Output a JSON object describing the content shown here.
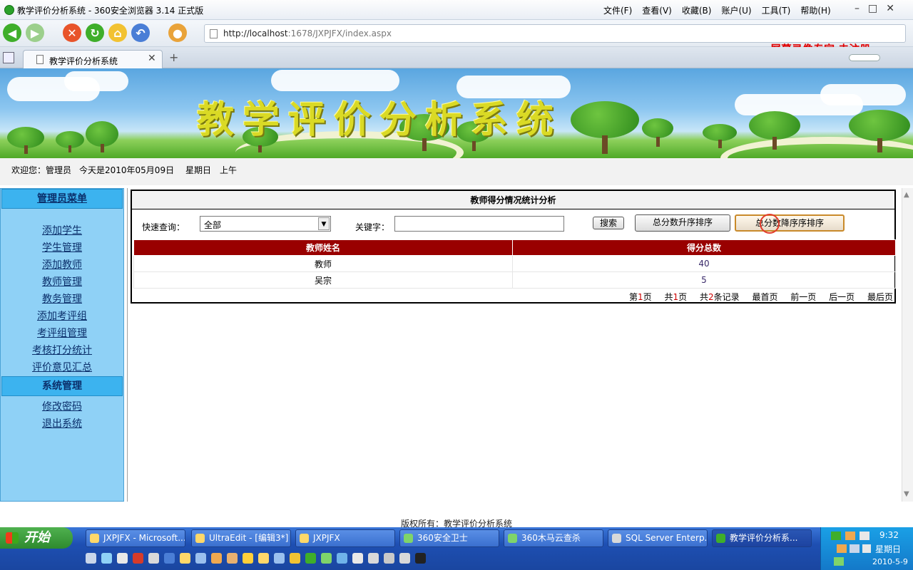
{
  "browser": {
    "title": "教学评价分析系统 - 360安全浏览器 3.14 正式版",
    "menus": [
      "文件(F)",
      "查看(V)",
      "收藏(B)",
      "账户(U)",
      "工具(T)",
      "帮助(H)"
    ],
    "url_host": "http://localhost",
    "url_path": ":1678/JXPJFX/index.aspx",
    "recorder_label": "屏幕录像专家  未注册",
    "tab_label": "教学评价分析系统"
  },
  "banner": {
    "title": "教学评价分析系统"
  },
  "welcome": {
    "greeting": "欢迎您：管理员",
    "date": "今天是2010年05月09日",
    "weekday": "星期日",
    "period": "上午"
  },
  "menu": {
    "header": "管理员菜单",
    "items": [
      "添加学生",
      "学生管理",
      "添加教师",
      "教师管理",
      "教务管理",
      "添加考评组",
      "考评组管理",
      "考核打分统计",
      "评价意见汇总"
    ],
    "section2_header": "系统管理",
    "section2_items": [
      "修改密码",
      "退出系统"
    ]
  },
  "panel": {
    "title": "教师得分情况统计分析",
    "quick_label": "快速查询：",
    "select_value": "全部",
    "keyword_label": "关键字：",
    "keyword_value": "",
    "search_btn": "搜索",
    "asc_btn": "总分数升序排序",
    "desc_btn": "总分数降序序排序",
    "columns": [
      "教师姓名",
      "得分总数"
    ],
    "rows": [
      {
        "name": "教师",
        "score": "40"
      },
      {
        "name": "吴宗",
        "score": "5"
      }
    ],
    "pager": {
      "page_prefix": "第",
      "page_num": "1",
      "page_suffix": "页",
      "total_prefix": "共",
      "total_num": "1",
      "total_suffix": "页",
      "rec_prefix": "共",
      "rec_num": "2",
      "rec_suffix": "条记录",
      "first": "最首页",
      "prev": "前一页",
      "next": "后一页",
      "last": "最后页"
    }
  },
  "footer": {
    "copyright": "版权所有：教学评价分析系统"
  },
  "taskbar": {
    "start": "开始",
    "tasks": [
      "JXPJFX - Microsoft...",
      "UltraEdit - [编辑3*]",
      "JXPJFX",
      "360安全卫士",
      "360木马云查杀",
      "SQL Server Enterp...",
      "教学评价分析系..."
    ],
    "time": "9:32",
    "weekday": "星期日",
    "date": "2010-5-9"
  }
}
